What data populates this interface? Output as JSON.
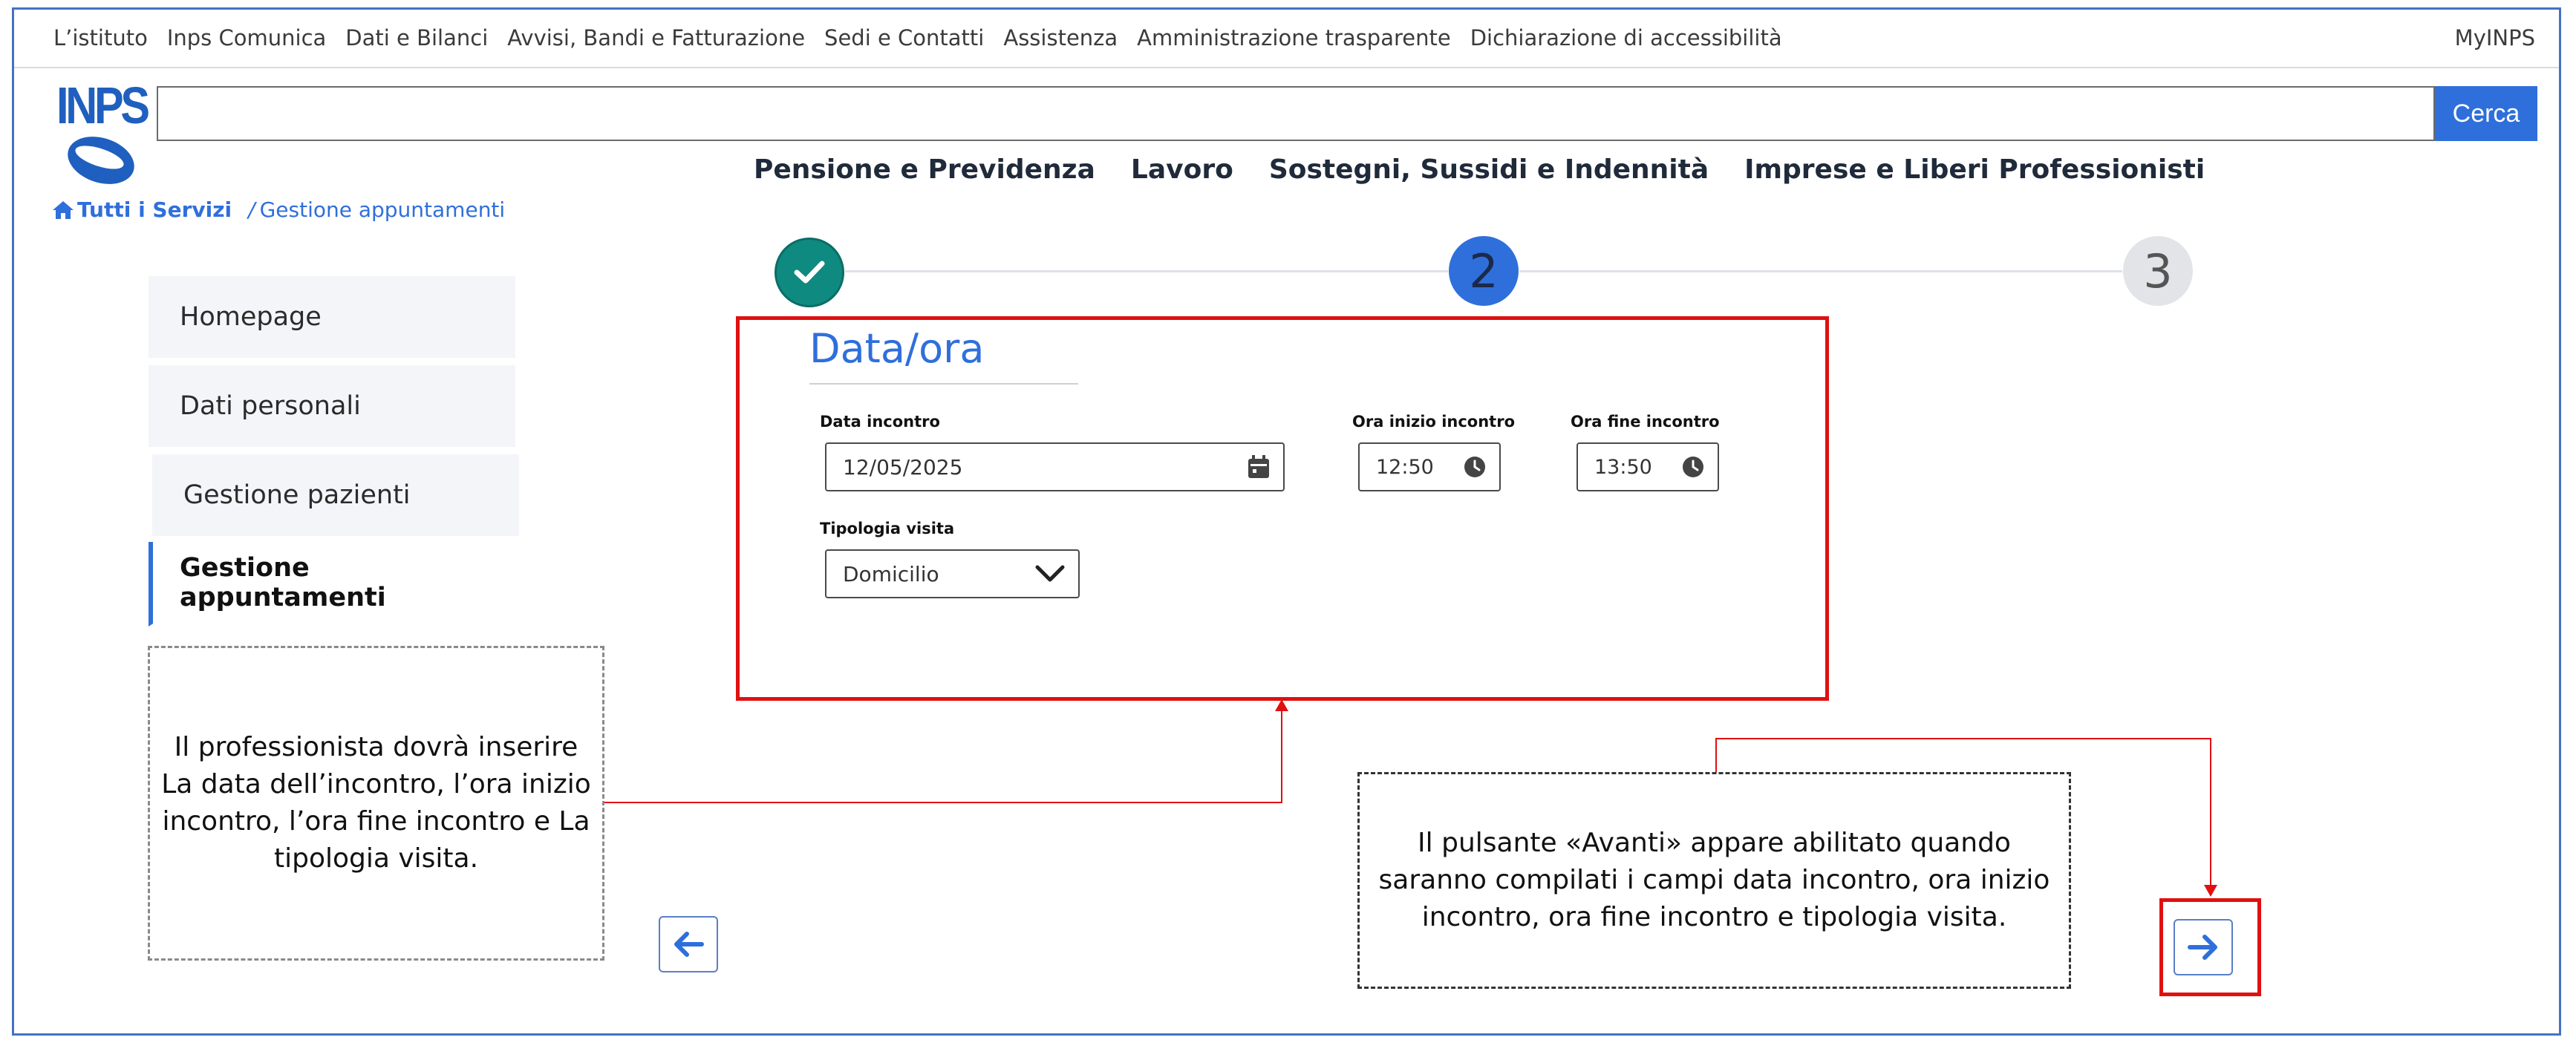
{
  "header": {
    "utility_links": [
      "L’istituto",
      "Inps Comunica",
      "Dati e Bilanci",
      "Avvisi, Bandi e Fatturazione",
      "Sedi e Contatti",
      "Assistenza",
      "Amministrazione trasparente",
      "Dichiarazione di accessibilità"
    ],
    "myinps": "MyINPS",
    "logo_text": "INPS",
    "search": {
      "value": "",
      "button_label": "Cerca"
    },
    "main_nav": [
      "Pensione e Previdenza",
      "Lavoro",
      "Sostegni, Sussidi e Indennità",
      "Imprese e Liberi Professionisti"
    ]
  },
  "breadcrumb": {
    "home": "Tutti i Servizi",
    "separator": "/",
    "current": "Gestione appuntamenti"
  },
  "sidebar": {
    "items": [
      {
        "label": "Homepage",
        "active": false
      },
      {
        "label": "Dati personali",
        "active": false
      },
      {
        "label": "Gestione pazienti",
        "active": false
      },
      {
        "label": "Gestione appuntamenti",
        "active": true
      }
    ]
  },
  "stepper": {
    "steps": [
      {
        "label": "",
        "state": "completed"
      },
      {
        "label": "2",
        "state": "current"
      },
      {
        "label": "3",
        "state": "upcoming"
      }
    ]
  },
  "form": {
    "title": "Data/ora",
    "date_label": "Data incontro",
    "date_value": "12/05/2025",
    "start_label": "Ora inizio incontro",
    "start_value": "12:50",
    "end_label": "Ora fine incontro",
    "end_value": "13:50",
    "type_label": "Tipologia visita",
    "type_value": "Domicilio"
  },
  "annotations": {
    "left_note": "Il professionista dovrà inserire La data dell’incontro, l’ora inizio incontro, l’ora fine incontro e La tipologia visita.",
    "right_note": "Il pulsante «Avanti» appare abilitato quando saranno compilati i campi data incontro, ora inizio incontro, ora fine incontro e tipologia visita."
  },
  "colors": {
    "brand_blue": "#2f6fdb",
    "completed_step": "#0f8a80",
    "annotation_red": "#e01010"
  }
}
